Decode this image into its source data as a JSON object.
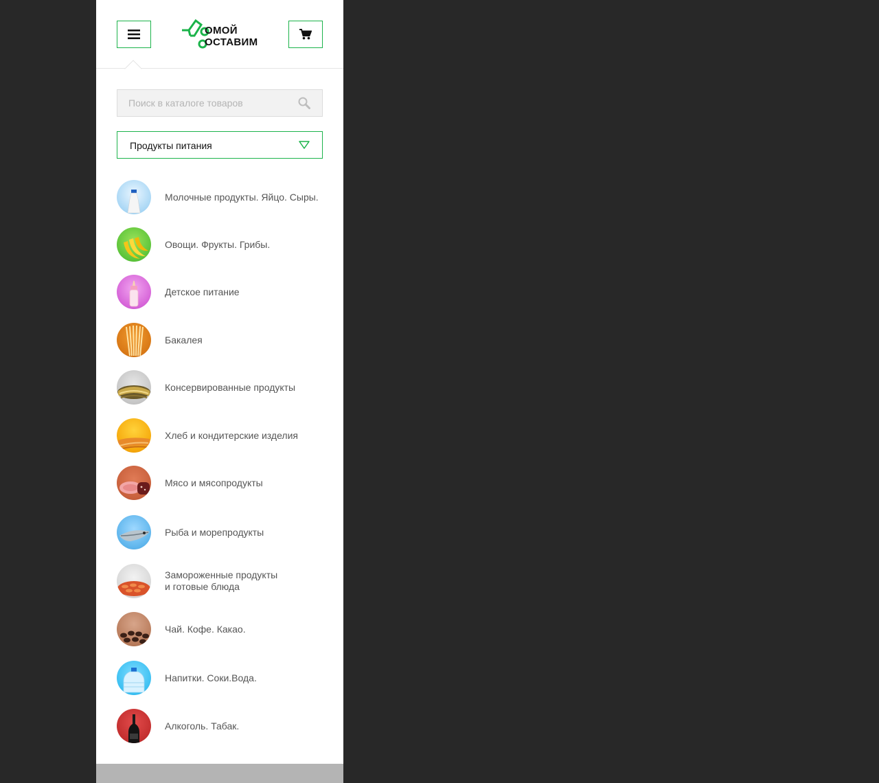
{
  "header": {
    "logo_line1": "ОМОЙ",
    "logo_line2": "ОСТАВИМ",
    "brand_color": "#1bb34a",
    "menu_icon": "hamburger-icon",
    "cart_icon": "cart-icon"
  },
  "search": {
    "placeholder": "Поиск в каталоге товаров",
    "value": ""
  },
  "category_select": {
    "selected": "Продукты питания"
  },
  "categories": [
    {
      "label": "Молочные продукты. Яйцо. Сыры.",
      "icon": "milk-bottle-icon"
    },
    {
      "label": "Овощи. Фрукты. Грибы.",
      "icon": "banana-icon"
    },
    {
      "label": "Детское питание",
      "icon": "baby-bottle-icon"
    },
    {
      "label": "Бакалея",
      "icon": "pasta-icon"
    },
    {
      "label": "Консервированные продукты",
      "icon": "canned-food-icon"
    },
    {
      "label": "Хлеб и кондитерские изделия",
      "icon": "bread-icon"
    },
    {
      "label": "Мясо и мясопродукты",
      "icon": "meat-icon"
    },
    {
      "label": "Рыба и морепродукты",
      "icon": "fish-icon"
    },
    {
      "label": "Замороженные продукты\nи готовые блюда",
      "icon": "frozen-food-icon"
    },
    {
      "label": "Чай. Кофе. Какао.",
      "icon": "coffee-beans-icon"
    },
    {
      "label": "Напитки. Соки.Вода.",
      "icon": "water-bottle-icon"
    },
    {
      "label": "Алкоголь. Табак.",
      "icon": "wine-bottle-icon"
    }
  ]
}
